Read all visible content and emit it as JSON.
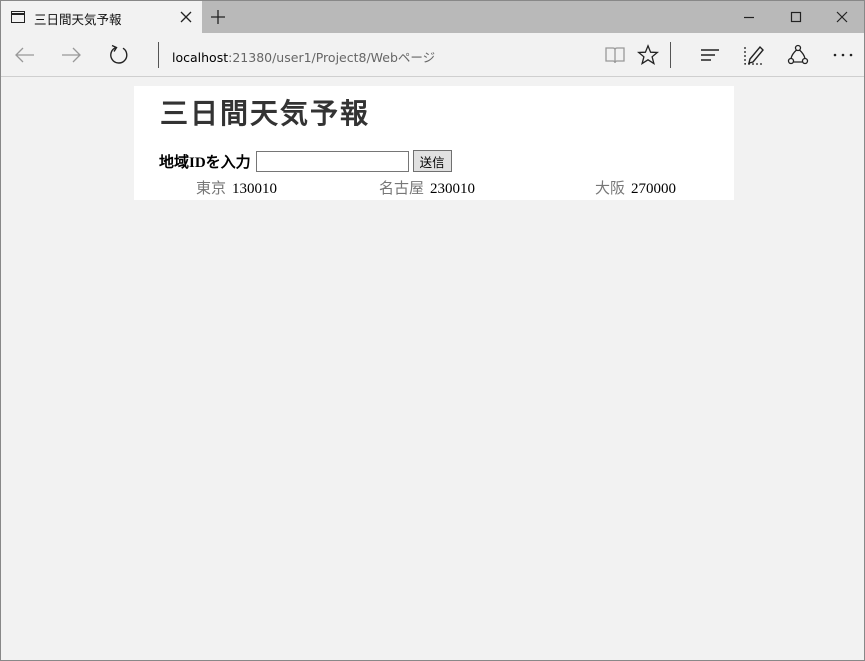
{
  "browser": {
    "tab_title": "三日間天気予報",
    "url_host": "localhost",
    "url_rest": ":21380/user1/Project8/Webページ"
  },
  "page": {
    "title": "三日間天気予報",
    "form": {
      "label": "地域IDを入力",
      "input_value": "",
      "submit_label": "送信"
    },
    "regions": [
      {
        "name": "東京",
        "id": "130010"
      },
      {
        "name": "名古屋",
        "id": "230010"
      },
      {
        "name": "大阪",
        "id": "270000"
      }
    ]
  },
  "icons": {
    "tab": "tab-page-icon",
    "tab_close": "close-icon",
    "new_tab": "plus-icon",
    "minimize": "minimize-icon",
    "maximize": "maximize-icon",
    "close_window": "close-icon",
    "back": "arrow-left-icon",
    "forward": "arrow-right-icon",
    "refresh": "refresh-icon",
    "reading_view": "book-icon",
    "favorites": "star-icon",
    "hub": "hub-icon",
    "web_note": "pen-note-icon",
    "share": "share-icon",
    "more": "more-icon"
  }
}
